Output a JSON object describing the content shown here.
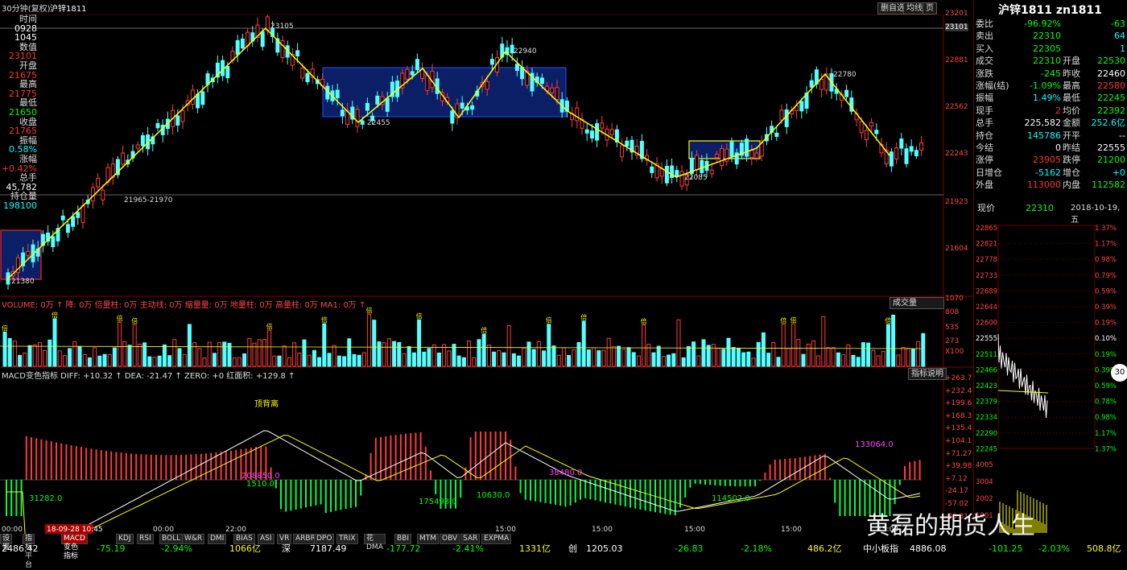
{
  "header": {
    "period": "30分钟(复权)",
    "symbol": "沪锌1811",
    "buttons": [
      "删自选",
      "均线",
      "页"
    ]
  },
  "left_info": [
    {
      "label": "时间",
      "value": "0928",
      "color": "#ffffff"
    },
    {
      "label": "",
      "value": "1045",
      "color": "#ffffff"
    },
    {
      "label": "数值",
      "value": "23101",
      "color": "#ff3333"
    },
    {
      "label": "开盘",
      "value": "21675",
      "color": "#ff3333"
    },
    {
      "label": "最高",
      "value": "21775",
      "color": "#ff3333"
    },
    {
      "label": "最低",
      "value": "21650",
      "color": "#00ff00"
    },
    {
      "label": "收盘",
      "value": "21765",
      "color": "#ff3333"
    },
    {
      "label": "振幅",
      "value": "0.58%",
      "color": "#00ffff"
    },
    {
      "label": "涨幅",
      "value": "+0.42%",
      "color": "#ff3333"
    },
    {
      "label": "总手",
      "value": "45,782",
      "color": "#ffffff"
    },
    {
      "label": "持仓量",
      "value": "198100",
      "color": "#00ffff"
    }
  ],
  "price_axis": [
    "23201",
    "23101",
    "22881",
    "22562",
    "22243",
    "21923",
    "21604"
  ],
  "annotations": {
    "peak1": "23105",
    "low1": "22455",
    "peak2": "22940",
    "low2": "22085",
    "peak3": "22780",
    "low0": "21380",
    "range": "21965-21970"
  },
  "volume_panel": {
    "label": "VOLUME: 0万 ↑ 降: 0万 倍量柱: 0万 主动线: 0万 缩量量: 0万 地量柱: 0万 高量柱: 0万 MA1: 0万 ↑",
    "selector": "成交量",
    "axis": [
      "1070",
      "808",
      "535",
      "273",
      "X100"
    ],
    "marker": "倍"
  },
  "macd_panel": {
    "label": "MACD变色指标 DIFF: +10.32 ↑ DEA: -21.47 ↑ ZERO: +0 红面积: +129.8 ↑",
    "button": "指标说明",
    "axis": [
      "+263.7",
      "+232.4",
      "+199.6",
      "+168.3",
      "+135.4",
      "+104.1",
      "+71.27",
      "+39.98",
      "+7.12",
      "-24.17",
      "-57.02",
      "-88.31"
    ],
    "annotations": {
      "top_div": "顶背离",
      "a1": "31282.0",
      "a2": "208850.0",
      "a3": "1510.0",
      "a4": "175498.0",
      "a5": "10630.0",
      "a6": "38480.0",
      "a7": "114502.0",
      "a8": "133064.0"
    }
  },
  "time_axis": {
    "labels": [
      "00:00",
      "18-09-28 10:45",
      "00:00",
      "22:00",
      "15:00",
      "15:00",
      "15:00",
      "15:00",
      "15:00"
    ]
  },
  "right_panel": {
    "title": "沪锌1811 zn1811",
    "quote_rows": [
      {
        "l1": "委比",
        "v1": "-96.92%",
        "c1": "#00ff00",
        "l2": "",
        "v2": "-63",
        "c2": "#00ff00"
      },
      {
        "l1": "卖出",
        "v1": "22310",
        "c1": "#00ff00",
        "l2": "",
        "v2": "64",
        "c2": "#00ffff"
      },
      {
        "l1": "买入",
        "v1": "22305",
        "c1": "#00ff00",
        "l2": "",
        "v2": "1",
        "c2": "#00ffff"
      },
      {
        "l1": "成交",
        "v1": "22310",
        "c1": "#00ff00",
        "l2": "开盘",
        "v2": "22530",
        "c2": "#00ff00"
      },
      {
        "l1": "涨跌",
        "v1": "-245",
        "c1": "#00ff00",
        "l2": "昨收",
        "v2": "22460",
        "c2": "#ffffff"
      },
      {
        "l1": "涨幅(结)",
        "v1": "-1.09%",
        "c1": "#00ff00",
        "l2": "最高",
        "v2": "22580",
        "c2": "#ff3333"
      },
      {
        "l1": "振幅",
        "v1": "1.49%",
        "c1": "#00ffff",
        "l2": "最低",
        "v2": "22245",
        "c2": "#00ff00"
      },
      {
        "l1": "现手",
        "v1": "2",
        "c1": "#ff3333",
        "l2": "均价",
        "v2": "22392",
        "c2": "#00ff00"
      },
      {
        "l1": "总手",
        "v1": "225,582",
        "c1": "#ffffff",
        "l2": "金额",
        "v2": "252.6亿",
        "c2": "#00ffff"
      },
      {
        "l1": "持仓",
        "v1": "145786",
        "c1": "#00ffff",
        "l2": "开平",
        "v2": "--",
        "c2": "#ffffff"
      },
      {
        "l1": "今结",
        "v1": "0",
        "c1": "#ffffff",
        "l2": "昨结",
        "v2": "22555",
        "c2": "#ffffff"
      },
      {
        "l1": "涨停",
        "v1": "23905",
        "c1": "#ff3333",
        "l2": "跌停",
        "v2": "21200",
        "c2": "#00ff00"
      },
      {
        "l1": "日增仓",
        "v1": "-5162",
        "c1": "#00ffff",
        "l2": "增仓",
        "v2": "+0",
        "c2": "#00ffff"
      },
      {
        "l1": "外盘",
        "v1": "113000",
        "c1": "#ff3333",
        "l2": "内盘",
        "v2": "112582",
        "c2": "#00ff00"
      }
    ],
    "now_label": "现价",
    "now_value": "22310",
    "date": "2018-10-19,五",
    "mini_axis_left": [
      "22865",
      "22821",
      "22778",
      "22733",
      "22689",
      "22644",
      "22600",
      "22555",
      "22511",
      "22466",
      "22423",
      "22379",
      "22334",
      "22290",
      "22245"
    ],
    "mini_axis_right": [
      "1.37%",
      "1.17%",
      "0.98%",
      "0.79%",
      "0.59%",
      "0.39%",
      "0.19%",
      "0.10%",
      "0.19%",
      "0.39%",
      "0.59%",
      "0.78%",
      "0.98%",
      "1.17%",
      "1.37%"
    ],
    "mini_vol_axis": [
      "4005",
      "3004",
      "2002",
      "1001"
    ],
    "badge": "30"
  },
  "bottom_tabs": [
    "设置",
    "指标平台",
    "MACD变色指标",
    "KDJ",
    "RSI",
    "BOLL",
    "W&R",
    "DMI",
    "BIAS",
    "ASI",
    "VR",
    "ARBR",
    "DPO",
    "TRIX",
    "花DMA",
    "BBI",
    "MTM",
    "OBV",
    "SAR",
    "EXPMA"
  ],
  "ticker": [
    {
      "text": "2486.42",
      "color": "#ffffff"
    },
    {
      "text": "-75.19",
      "color": "#00ff00"
    },
    {
      "text": "-2.94%",
      "color": "#00ff00"
    },
    {
      "text": "1066亿",
      "color": "#ffff00"
    },
    {
      "text": "深",
      "color": "#ffffff"
    },
    {
      "text": "7187.49",
      "color": "#ffffff"
    },
    {
      "text": "-177.72",
      "color": "#00ff00"
    },
    {
      "text": "-2.41%",
      "color": "#00ff00"
    },
    {
      "text": "1331亿",
      "color": "#ffff00"
    },
    {
      "text": "创",
      "color": "#ffffff"
    },
    {
      "text": "1205.03",
      "color": "#ffffff"
    },
    {
      "text": "-26.83",
      "color": "#00ff00"
    },
    {
      "text": "-2.18%",
      "color": "#00ff00"
    },
    {
      "text": "486.2亿",
      "color": "#ffff00"
    },
    {
      "text": "中小板指",
      "color": "#ffffff"
    },
    {
      "text": "4886.08",
      "color": "#ffffff"
    },
    {
      "text": "-101.25",
      "color": "#00ff00"
    },
    {
      "text": "-2.03%",
      "color": "#00ff00"
    },
    {
      "text": "508.8亿",
      "color": "#ffff00"
    }
  ],
  "watermark": "黄磊的期货人生"
}
